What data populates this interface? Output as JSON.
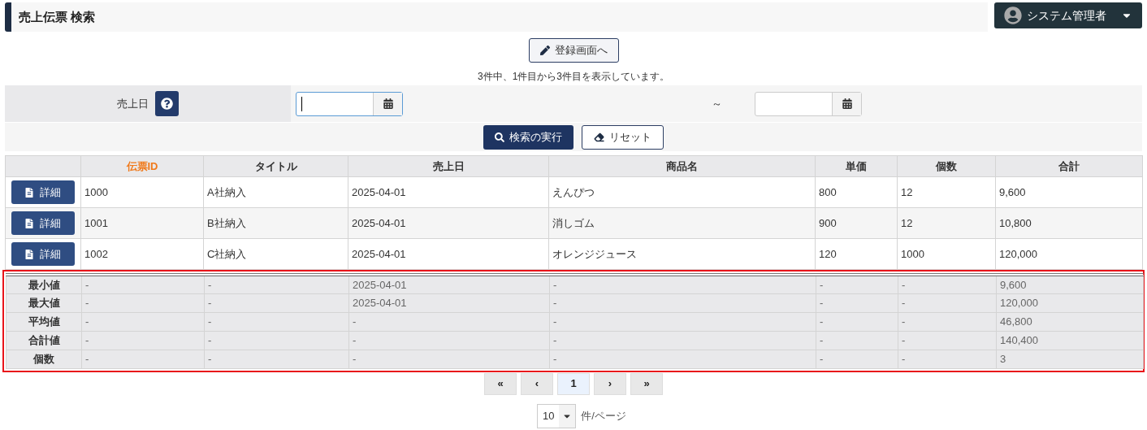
{
  "header": {
    "title": "売上伝票 検索",
    "user_menu": {
      "label": "システム管理者"
    }
  },
  "register_button": {
    "label": "登録画面へ"
  },
  "result_message": "3件中、1件目から3件目を表示しています。",
  "search": {
    "field_label": "売上日",
    "date_from": {
      "focused": true
    },
    "separator": "～",
    "date_to": {
      "focused": false
    },
    "search_button": "検索の実行",
    "reset_button": "リセット"
  },
  "table": {
    "columns": [
      {
        "label": "伝票ID",
        "sorted": true
      },
      {
        "label": "タイトル",
        "sorted": false
      },
      {
        "label": "売上日",
        "sorted": false
      },
      {
        "label": "商品名",
        "sorted": false
      },
      {
        "label": "単価",
        "sorted": false
      },
      {
        "label": "個数",
        "sorted": false
      },
      {
        "label": "合計",
        "sorted": false
      }
    ],
    "rows": [
      {
        "detail_button": "詳細",
        "cells": [
          "1000",
          "A社納入",
          "2025-04-01",
          "えんぴつ",
          "800",
          "12",
          "9,600"
        ]
      },
      {
        "detail_button": "詳細",
        "cells": [
          "1001",
          "B社納入",
          "2025-04-01",
          "消しゴム",
          "900",
          "12",
          "10,800"
        ]
      },
      {
        "detail_button": "詳細",
        "cells": [
          "1002",
          "C社納入",
          "2025-04-01",
          "オレンジジュース",
          "120",
          "1000",
          "120,000"
        ]
      }
    ],
    "summary_highlighted": true,
    "summary_rows": [
      {
        "label": "最小値",
        "cells": [
          "-",
          "-",
          "2025-04-01",
          "-",
          "-",
          "-",
          "9,600"
        ]
      },
      {
        "label": "最大値",
        "cells": [
          "-",
          "-",
          "2025-04-01",
          "-",
          "-",
          "-",
          "120,000"
        ]
      },
      {
        "label": "平均値",
        "cells": [
          "-",
          "-",
          "-",
          "-",
          "-",
          "-",
          "46,800"
        ]
      },
      {
        "label": "合計値",
        "cells": [
          "-",
          "-",
          "-",
          "-",
          "-",
          "-",
          "140,400"
        ]
      },
      {
        "label": "個数",
        "cells": [
          "-",
          "-",
          "-",
          "-",
          "-",
          "-",
          "3"
        ]
      }
    ]
  },
  "pagination": [
    {
      "label": "«",
      "selected": false
    },
    {
      "label": "‹",
      "selected": false
    },
    {
      "label": "1",
      "selected": true
    },
    {
      "label": "›",
      "selected": false
    },
    {
      "label": "»",
      "selected": false
    }
  ],
  "page_size": {
    "value": "10",
    "unit": "件/ページ"
  }
}
